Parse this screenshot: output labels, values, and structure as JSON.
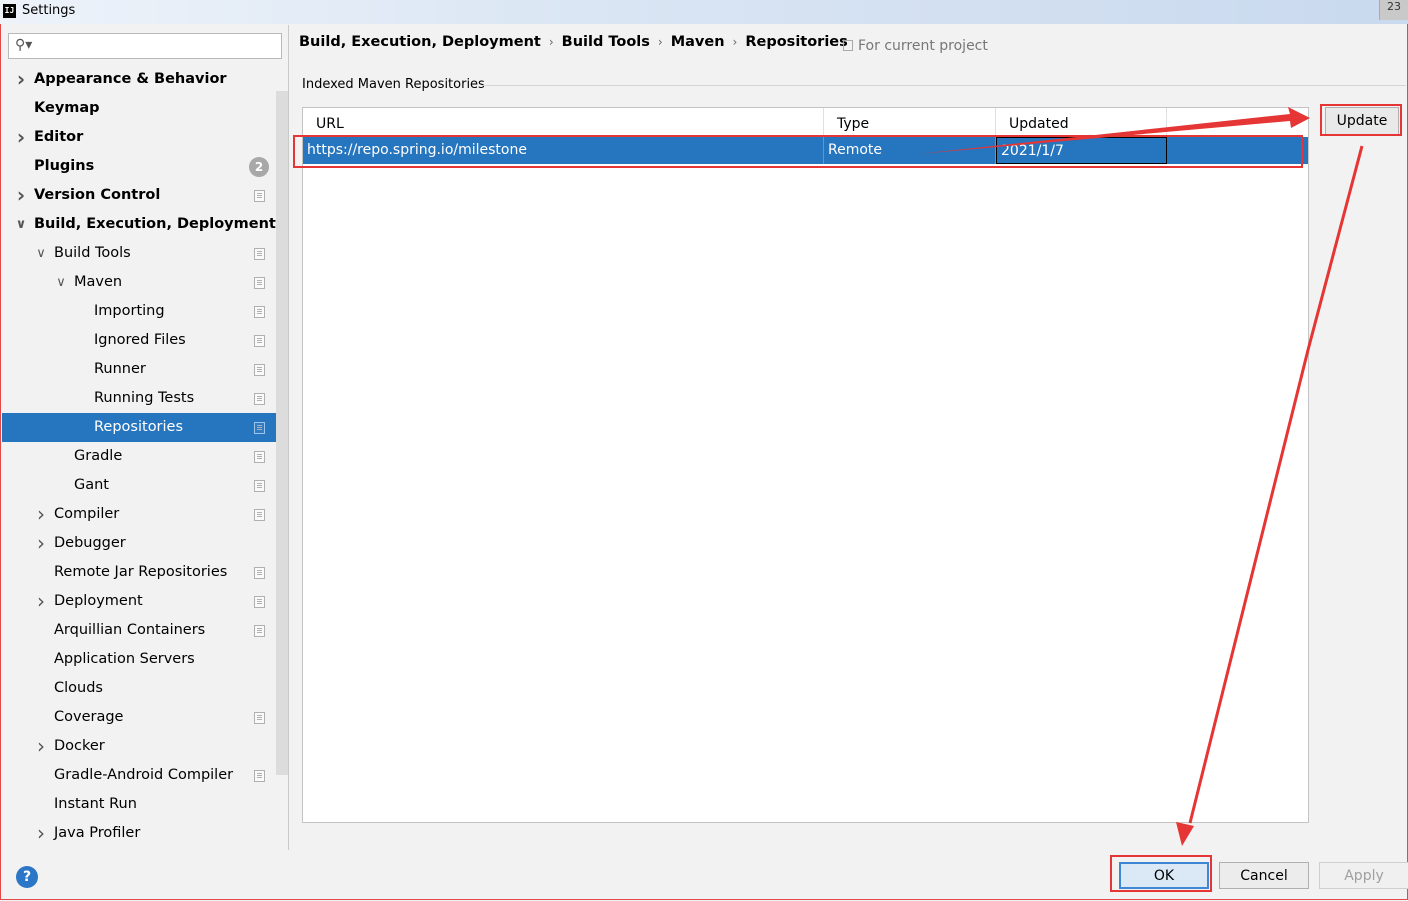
{
  "window": {
    "title": "Settings",
    "app_icon_text": "IJ",
    "close_glyph": "23"
  },
  "sidebar": {
    "search": {
      "placeholder": "",
      "value": "",
      "icon": "search-icon"
    },
    "items": [
      {
        "label": "Appearance & Behavior",
        "level": 0,
        "bold": true,
        "arrow": "right"
      },
      {
        "label": "Keymap",
        "level": 0,
        "bold": true,
        "arrow": "none"
      },
      {
        "label": "Editor",
        "level": 0,
        "bold": true,
        "arrow": "right"
      },
      {
        "label": "Plugins",
        "level": 0,
        "bold": true,
        "arrow": "none",
        "badge": "2"
      },
      {
        "label": "Version Control",
        "level": 0,
        "bold": true,
        "arrow": "right",
        "project_icon": true
      },
      {
        "label": "Build, Execution, Deployment",
        "level": 0,
        "bold": true,
        "arrow": "down"
      },
      {
        "label": "Build Tools",
        "level": 1,
        "arrow": "down",
        "project_icon": true
      },
      {
        "label": "Maven",
        "level": 2,
        "arrow": "down",
        "project_icon": true
      },
      {
        "label": "Importing",
        "level": 3,
        "arrow": "none",
        "project_icon": true
      },
      {
        "label": "Ignored Files",
        "level": 3,
        "arrow": "none",
        "project_icon": true
      },
      {
        "label": "Runner",
        "level": 3,
        "arrow": "none",
        "project_icon": true
      },
      {
        "label": "Running Tests",
        "level": 3,
        "arrow": "none",
        "project_icon": true
      },
      {
        "label": "Repositories",
        "level": 3,
        "arrow": "none",
        "project_icon": true,
        "selected": true
      },
      {
        "label": "Gradle",
        "level": 2,
        "arrow": "none",
        "project_icon": true
      },
      {
        "label": "Gant",
        "level": 2,
        "arrow": "none",
        "project_icon": true
      },
      {
        "label": "Compiler",
        "level": 1,
        "arrow": "right",
        "project_icon": true
      },
      {
        "label": "Debugger",
        "level": 1,
        "arrow": "right"
      },
      {
        "label": "Remote Jar Repositories",
        "level": 1,
        "arrow": "none",
        "project_icon": true
      },
      {
        "label": "Deployment",
        "level": 1,
        "arrow": "right",
        "project_icon": true
      },
      {
        "label": "Arquillian Containers",
        "level": 1,
        "arrow": "none",
        "project_icon": true
      },
      {
        "label": "Application Servers",
        "level": 1,
        "arrow": "none"
      },
      {
        "label": "Clouds",
        "level": 1,
        "arrow": "none"
      },
      {
        "label": "Coverage",
        "level": 1,
        "arrow": "none",
        "project_icon": true
      },
      {
        "label": "Docker",
        "level": 1,
        "arrow": "right"
      },
      {
        "label": "Gradle-Android Compiler",
        "level": 1,
        "arrow": "none",
        "project_icon": true
      },
      {
        "label": "Instant Run",
        "level": 1,
        "arrow": "none"
      },
      {
        "label": "Java Profiler",
        "level": 1,
        "arrow": "right"
      }
    ]
  },
  "breadcrumb": [
    "Build, Execution, Deployment",
    "Build Tools",
    "Maven",
    "Repositories"
  ],
  "breadcrumb_separator": "›",
  "scope_label": "For current project",
  "section_label": "Indexed Maven Repositories",
  "table": {
    "columns": [
      "URL",
      "Type",
      "Updated"
    ],
    "rows": [
      {
        "url": "https://repo.spring.io/milestone",
        "type": "Remote",
        "updated": "2021/1/7",
        "selected": true
      }
    ]
  },
  "buttons": {
    "update": "Update",
    "ok": "OK",
    "cancel": "Cancel",
    "apply": "Apply",
    "help": "?"
  },
  "colors": {
    "selection": "#2675bf",
    "annotation": "#e53535"
  }
}
